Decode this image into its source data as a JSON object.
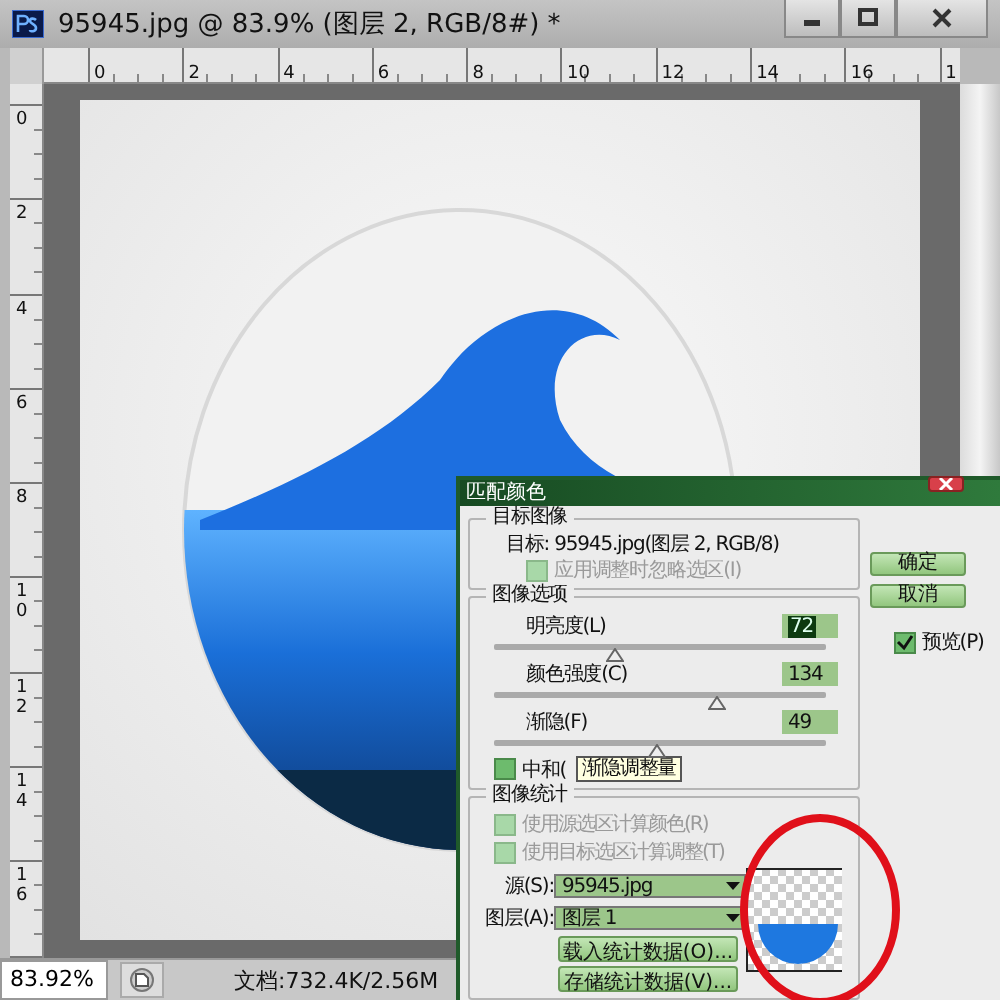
{
  "window": {
    "title": "95945.jpg @ 83.9% (图层 2, RGB/8#) *"
  },
  "rulers": {
    "horizontal": [
      "0",
      "2",
      "4",
      "6",
      "8",
      "10",
      "12",
      "14",
      "16",
      "1"
    ],
    "vertical": [
      "0",
      "2",
      "4",
      "6",
      "8",
      "10",
      "12",
      "14",
      "16"
    ]
  },
  "dialog": {
    "title": "匹配颜色",
    "target_group": {
      "heading": "目标图像",
      "target": "目标: 95945.jpg(图层 2, RGB/8)",
      "ignore_selection": {
        "label": "应用调整时忽略选区(I)",
        "checked": false,
        "disabled": true
      }
    },
    "options_group": {
      "heading": "图像选项",
      "sliders": [
        {
          "label": "明亮度(L)",
          "value": "72",
          "level": 0.36,
          "focused": true
        },
        {
          "label": "颜色强度(C)",
          "value": "134",
          "level": 0.67,
          "focused": false
        },
        {
          "label": "渐隐(F)",
          "value": "49",
          "level": 0.49,
          "focused": false
        }
      ],
      "neutralize": {
        "label": "中和(",
        "checked": false,
        "disabled": false
      },
      "tooltip": "渐隐调整量"
    },
    "statistics_group": {
      "heading": "图像统计",
      "checkboxes": [
        {
          "label": "使用源选区计算颜色(R)",
          "checked": false,
          "disabled": true
        },
        {
          "label": "使用目标选区计算调整(T)",
          "checked": false,
          "disabled": true
        }
      ],
      "source": {
        "label": "源(S):",
        "value": "95945.jpg"
      },
      "layer": {
        "label": "图层(A):",
        "value": "图层 1"
      },
      "buttons": [
        "载入统计数据(O)...",
        "存储统计数据(V)..."
      ]
    },
    "buttons": [
      "确定",
      "取消"
    ],
    "preview": {
      "label": "预览(P)",
      "checked": true,
      "disabled": false
    }
  },
  "status_bar": {
    "zoom": "83.92%",
    "document": "文档:732.4K/2.56M"
  }
}
